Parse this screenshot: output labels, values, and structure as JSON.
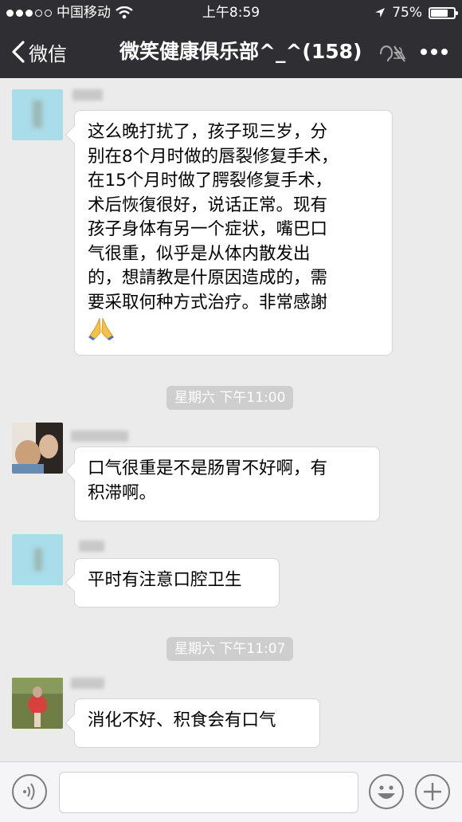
{
  "status_bar": {
    "carrier": "中国移动",
    "time": "上午8:59",
    "battery": "75%",
    "battery_level": 0.75
  },
  "nav": {
    "back_label": "微信",
    "title": "微笑健康俱乐部^_^(158)",
    "icons": [
      "chevron-left-icon",
      "mute-icon",
      "more-icon"
    ]
  },
  "messages": [
    {
      "text": "这么晚打扰了，孩子现三岁，分\n别在8个月时做的唇裂修复手术，\n在15个月时做了腭裂修复手术，\n术后恢復很好，说话正常。现有\n孩子身体有另一个症状，嘴巴口\n气很重，似乎是从体内散发出\n的，想請教是什原因造成的，需\n要采取何种方式治疗。非常感謝",
      "emoji": "pray-emoji"
    },
    {
      "text": "口气很重是不是肠胃不好啊，有\n积滞啊。"
    },
    {
      "text": "平时有注意口腔卫生"
    },
    {
      "text": "消化不好、积食会有口气"
    }
  ],
  "timestamps": [
    "星期六 下午11:00",
    "星期六 下午11:07"
  ],
  "input_bar": {
    "icons": [
      "voice-icon",
      "emoji-icon",
      "add-icon"
    ]
  }
}
